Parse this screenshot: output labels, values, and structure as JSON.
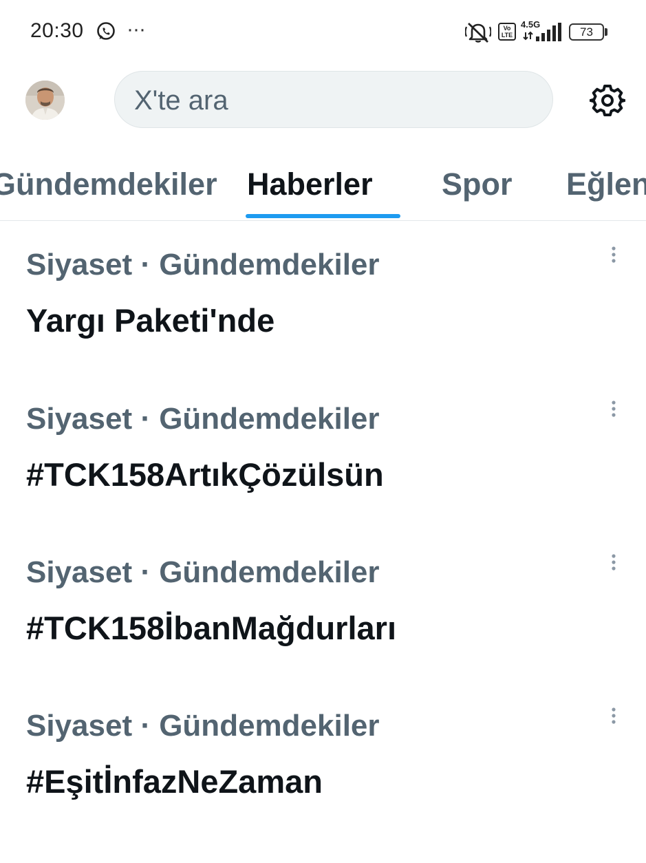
{
  "status_bar": {
    "time": "20:30",
    "more": "···",
    "network": "4.5G",
    "volte": "Vo\nLTE",
    "battery": "73"
  },
  "header": {
    "search_placeholder": "X'te ara"
  },
  "tabs": [
    {
      "label": "Gündemdekiler"
    },
    {
      "label": "Haberler"
    },
    {
      "label": "Spor"
    },
    {
      "label": "Eğlence"
    }
  ],
  "trends": [
    {
      "context": "Siyaset · Gündemdekiler",
      "title": "Yargı Paketi'nde"
    },
    {
      "context": "Siyaset · Gündemdekiler",
      "title": "#TCK158ArtıkÇözülsün"
    },
    {
      "context": "Siyaset · Gündemdekiler",
      "title": "#TCK158İbanMağdurları"
    },
    {
      "context": "Siyaset · Gündemdekiler",
      "title": "#EşitİnfazNeZaman"
    }
  ],
  "colors": {
    "accent": "#1d9bf0",
    "secondary_text": "#536471",
    "primary_text": "#0f1419",
    "search_bg": "#eff3f4"
  }
}
